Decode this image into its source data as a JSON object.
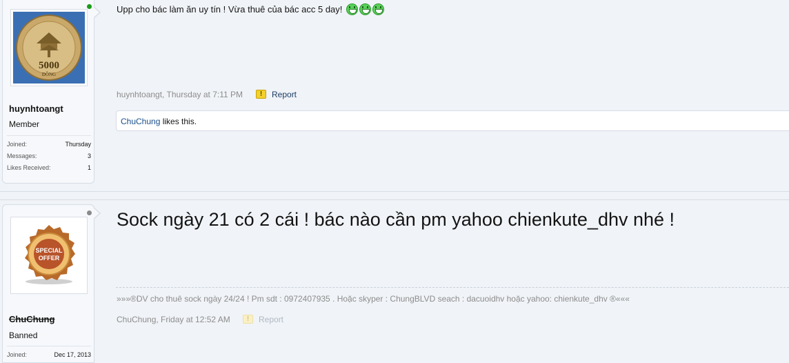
{
  "posts": [
    {
      "avatar": {
        "coin_value": "5000",
        "coin_unit": "ĐỒNG",
        "coin_ring": "NGÂN HÀNG NHÀ NƯỚC VIỆT NAM"
      },
      "username": "huynhtoangt",
      "user_title": "Member",
      "online": true,
      "stats": [
        {
          "label": "Joined:",
          "value": "Thursday"
        },
        {
          "label": "Messages:",
          "value": "3"
        },
        {
          "label": "Likes Received:",
          "value": "1"
        }
      ],
      "message": "Upp cho bác làm ăn uy tín ! Vừa thuê của bác acc 5 day!",
      "smileys": [
        "grin-icon",
        "grin-icon",
        "grin-icon"
      ],
      "meta": "huynhtoangt, Thursday at 7:11 PM",
      "report_label": "Report",
      "likes": {
        "liker": "ChuChung",
        "text": " likes this."
      }
    },
    {
      "avatar": {
        "badge_line1": "SPECIAL",
        "badge_line2": "OFFER",
        "badge_ring": "BEST OFFER · BEST OFFER · BEST OFFER ·"
      },
      "username": "ChuChung",
      "user_title": "Banned",
      "online": false,
      "stats": [
        {
          "label": "Joined:",
          "value": "Dec 17, 2013"
        }
      ],
      "message": "Sock ngày 21 có 2 cái ! bác nào cần pm yahoo chienkute_dhv nhé !",
      "signature": "»»»®DV cho thuê sock ngày 24/24 ! Pm sdt : 0972407935 . Hoặc skyper : ChungBLVD seach : dacuoidhv hoặc yahoo: chienkute_dhv ®«««",
      "meta": "ChuChung, Friday at 12:52 AM",
      "report_label": "Report"
    }
  ],
  "colors": {
    "page_bg": "#f0f3f7",
    "link": "#1a4e8a",
    "muted": "#8c8c8c",
    "online": "#1a9b1a",
    "offline": "#8a8a8a"
  }
}
